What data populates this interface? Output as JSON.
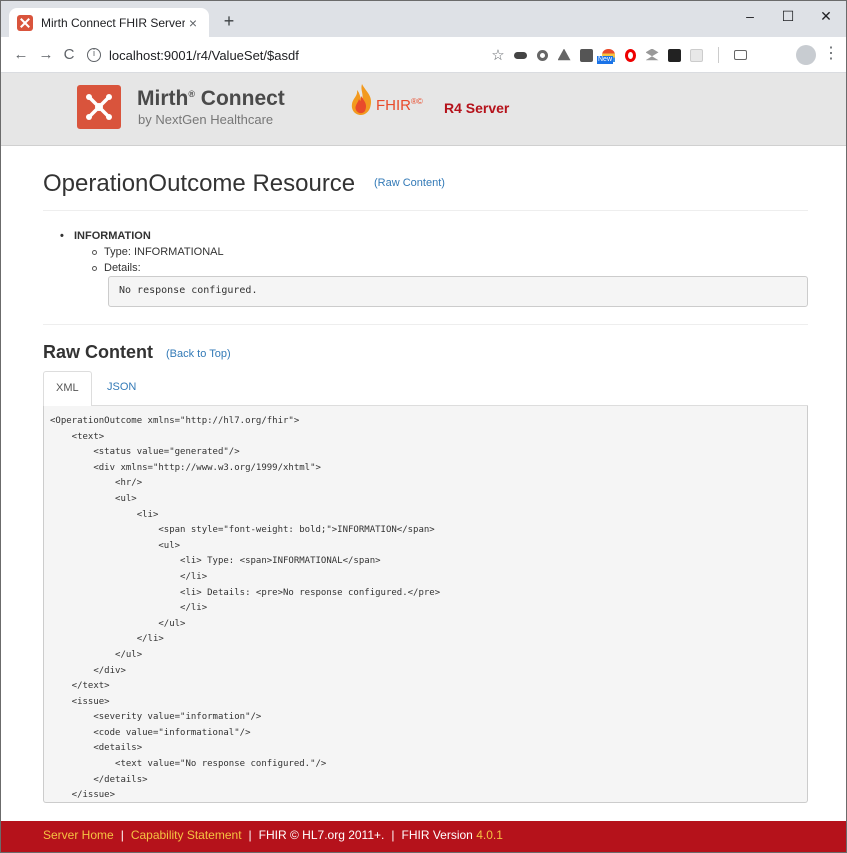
{
  "browser": {
    "tab_title": "Mirth Connect FHIR Server",
    "tab_close": "×",
    "new_tab": "+",
    "minimize": "–",
    "maximize": "☐",
    "close": "✕",
    "back": "←",
    "forward": "→",
    "reload": "C",
    "url": "localhost:9001/r4/ValueSet/$asdf",
    "bookmark_star": "☆",
    "menu": "⋮",
    "ext_new_badge": "New"
  },
  "header": {
    "brand_title": "Mirth",
    "brand_reg": "®",
    "brand_title2": " Connect",
    "brand_subtitle": "by NextGen Healthcare",
    "fhir_word": "FHIR",
    "fhir_sup": "®©",
    "server_label": "R4 Server"
  },
  "main": {
    "page_title": "OperationOutcome Resource",
    "raw_content_link_open": "(",
    "raw_content_link": "Raw Content",
    "raw_content_link_close": ")",
    "bullet": "•",
    "severity": "INFORMATION",
    "type_line": "Type: INFORMATIONAL",
    "details_label": "Details:",
    "details_text": "No response configured.",
    "raw_title": "Raw Content",
    "back_to_top_open": "(",
    "back_to_top": "Back to Top",
    "back_to_top_close": ")",
    "tabs": [
      {
        "label": "XML"
      },
      {
        "label": "JSON"
      }
    ],
    "xml_source": "<OperationOutcome xmlns=\"http://hl7.org/fhir\">\n    <text>\n        <status value=\"generated\"/>\n        <div xmlns=\"http://www.w3.org/1999/xhtml\">\n            <hr/>\n            <ul>\n                <li>\n                    <span style=\"font-weight: bold;\">INFORMATION</span>\n                    <ul>\n                        <li> Type: <span>INFORMATIONAL</span>\n                        </li>\n                        <li> Details: <pre>No response configured.</pre>\n                        </li>\n                    </ul>\n                </li>\n            </ul>\n        </div>\n    </text>\n    <issue>\n        <severity value=\"information\"/>\n        <code value=\"informational\"/>\n        <details>\n            <text value=\"No response configured.\"/>\n        </details>\n    </issue>\n</OperationOutcome>"
  },
  "footer": {
    "server_home": "Server Home",
    "capability_statement": "Capability Statement",
    "copyright": "FHIR © HL7.org 2011+.",
    "fhir_version_label": "FHIR Version",
    "fhir_version": "4.0.1",
    "separator": "|"
  },
  "colors": {
    "brand_red": "#d9543c",
    "footer_red": "#b5121b",
    "link_blue": "#337ab7",
    "footer_link": "#f5c342"
  }
}
